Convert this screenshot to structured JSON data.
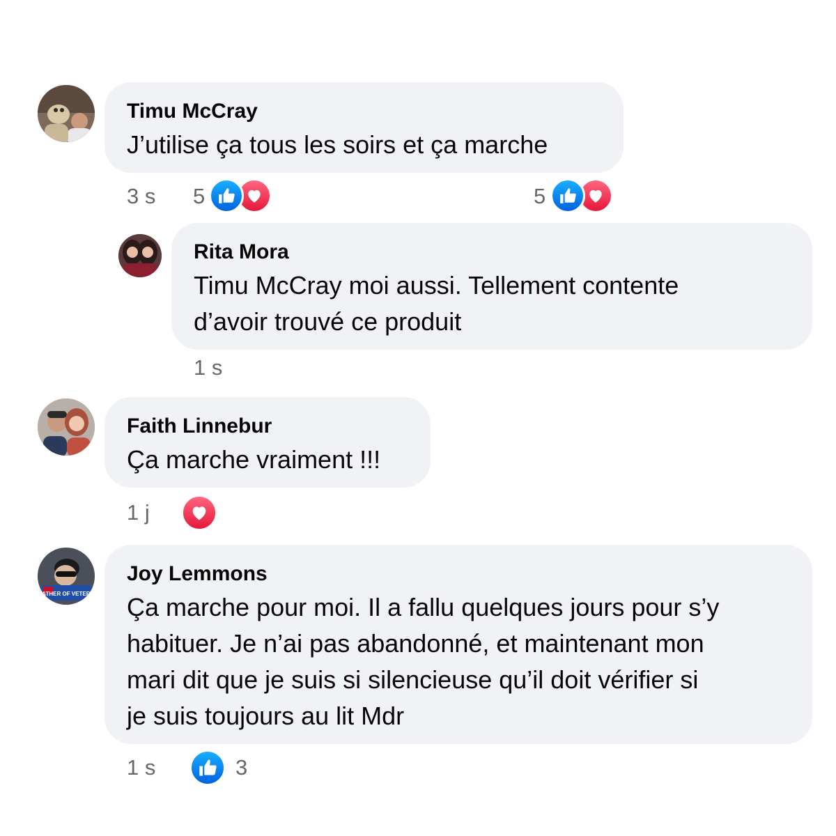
{
  "comments": [
    {
      "author": "Timu McCray",
      "text": "J’utilise ça tous les soirs et ça marche",
      "time": "3 s",
      "reaction_count": "5",
      "reaction_count_right": "5",
      "reactions": [
        "like-icon",
        "love-icon"
      ]
    },
    {
      "author": "Rita Mora",
      "text_line1": "Timu McCray moi aussi. Tellement contente",
      "text_line2": "d’avoir trouvé ce produit",
      "time": "1 s"
    },
    {
      "author": "Faith Linnebur",
      "text": "Ça marche vraiment !!!",
      "time": "1 j",
      "reactions": [
        "love-icon"
      ]
    },
    {
      "author": "Joy Lemmons",
      "text_line1": "Ça marche pour moi. Il a fallu quelques jours pour s’y",
      "text_line2": "habituer. Je n’ai pas abandonné, et maintenant mon",
      "text_line3": "mari dit que je suis si silencieuse qu’il doit vérifier si",
      "text_line4": "je suis toujours au lit Mdr",
      "time": "1 s",
      "reaction_count": "3",
      "reactions": [
        "like-icon"
      ],
      "avatar_badge": "EATHER OF VETERAN"
    }
  ],
  "colors": {
    "bubble": "#f0f2f5",
    "meta_text": "#65676b",
    "like": "#1877f2",
    "love": "#f33e58"
  }
}
